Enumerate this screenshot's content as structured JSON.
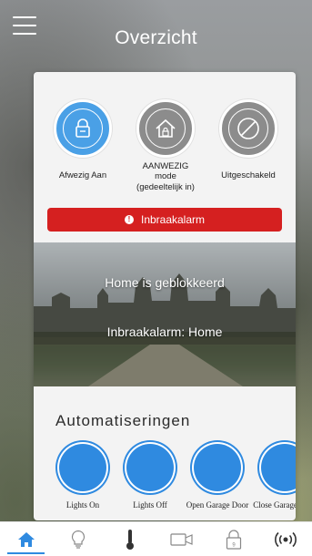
{
  "header": {
    "title": "Overzicht",
    "menu_icon": "hamburger-menu-icon"
  },
  "modes": [
    {
      "label": "Afwezig Aan",
      "icon": "lock-icon",
      "active": true,
      "color": "#4aa0e6"
    },
    {
      "label": "AANWEZIG mode (gedeeltelijk in)",
      "label_lines": [
        "AANWEZIG",
        "mode",
        "(gedeeltelijk in)"
      ],
      "icon": "house-lock-icon",
      "active": false,
      "color": "#8c8c8c"
    },
    {
      "label": "Uitgeschakeld",
      "icon": "prohibited-icon",
      "active": false,
      "color": "#8c8c8c"
    }
  ],
  "alarm_banner": {
    "label": "Inbraakalarm",
    "icon": "exclamation-icon",
    "color": "#d52020"
  },
  "camera": {
    "status_line1": "Home is geblokkeerd",
    "status_line2": "Inbraakalarm: Home"
  },
  "automations": {
    "title": "Automatiseringen",
    "items": [
      {
        "label": "Lights On"
      },
      {
        "label": "Lights Off"
      },
      {
        "label": "Open Garage Door"
      },
      {
        "label": "Close Garage Door"
      }
    ],
    "accent": "#2f8ae0"
  },
  "bottom_nav": {
    "items": [
      {
        "icon": "home-icon",
        "active": true
      },
      {
        "icon": "lightbulb-icon",
        "active": false
      },
      {
        "icon": "thermometer-icon",
        "active": false
      },
      {
        "icon": "camera-icon",
        "active": false
      },
      {
        "icon": "padlock-icon",
        "active": false
      },
      {
        "icon": "broadcast-icon",
        "active": false
      }
    ]
  }
}
